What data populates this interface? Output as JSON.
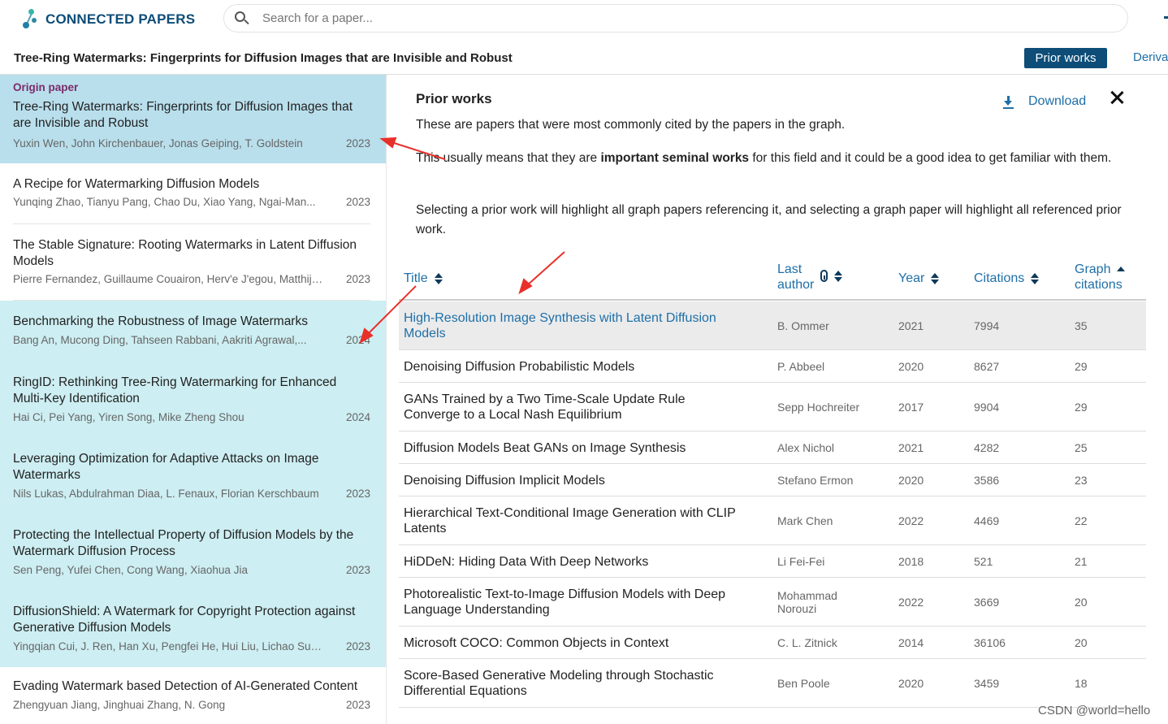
{
  "brand": {
    "name": "CONNECTED PAPERS"
  },
  "search": {
    "placeholder": "Search for a paper..."
  },
  "titlebar": {
    "paper_title": "Tree-Ring Watermarks: Fingerprints for Diffusion Images that are Invisible and Robust",
    "prior_works_label": "Prior works",
    "derivative_label": "Deriva"
  },
  "origin": {
    "label": "Origin paper",
    "title": "Tree-Ring Watermarks: Fingerprints for Diffusion Images that are Invisible and Robust",
    "authors": "Yuxin Wen, John Kirchenbauer, Jonas Geiping, T. Goldstein",
    "year": "2023"
  },
  "list": [
    {
      "title": "A Recipe for Watermarking Diffusion Models",
      "authors": "Yunqing Zhao, Tianyu Pang, Chao Du, Xiao Yang, Ngai-Man...",
      "year": "2023"
    },
    {
      "title": "The Stable Signature: Rooting Watermarks in Latent Diffusion Models",
      "authors": "Pierre Fernandez, Guillaume Couairon, Herv'e J'egou, Matthijs...",
      "year": "2023"
    },
    {
      "title": "Benchmarking the Robustness of Image Watermarks",
      "authors": "Bang An, Mucong Ding, Tahseen Rabbani, Aakriti Agrawal,...",
      "year": "2024"
    },
    {
      "title": "RingID: Rethinking Tree-Ring Watermarking for Enhanced Multi-Key Identification",
      "authors": "Hai Ci, Pei Yang, Yiren Song, Mike Zheng Shou",
      "year": "2024"
    },
    {
      "title": "Leveraging Optimization for Adaptive Attacks on Image Watermarks",
      "authors": "Nils Lukas, Abdulrahman Diaa, L. Fenaux, Florian Kerschbaum",
      "year": "2023"
    },
    {
      "title": "Protecting the Intellectual Property of Diffusion Models by the Watermark Diffusion Process",
      "authors": "Sen Peng, Yufei Chen, Cong Wang, Xiaohua Jia",
      "year": "2023"
    },
    {
      "title": "DiffusionShield: A Watermark for Copyright Protection against Generative Diffusion Models",
      "authors": "Yingqian Cui, J. Ren, Han Xu, Pengfei He, Hui Liu, Lichao Sun,...",
      "year": "2023"
    },
    {
      "title": "Evading Watermark based Detection of AI-Generated Content",
      "authors": "Zhengyuan Jiang, Jinghuai Zhang, N. Gong",
      "year": "2023"
    }
  ],
  "panel": {
    "title": "Prior works",
    "download_label": "Download",
    "desc1": "These are papers that were most commonly cited by the papers in the graph.",
    "desc2_pre": "This usually means that they are ",
    "desc2_bold": "important seminal works",
    "desc2_post": " for this field and it could be a good idea to get familiar with them.",
    "desc3": "Selecting a prior work will highlight all graph papers referencing it, and selecting a graph paper will highlight all referenced prior work."
  },
  "table": {
    "headers": {
      "title": "Title",
      "last_author_1": "Last",
      "last_author_2": "author",
      "year": "Year",
      "citations": "Citations",
      "graph_1": "Graph",
      "graph_2": "citations"
    },
    "rows": [
      {
        "title": "High-Resolution Image Synthesis with Latent Diffusion Models",
        "author": "B. Ommer",
        "year": "2021",
        "citations": "7994",
        "graph": "35"
      },
      {
        "title": "Denoising Diffusion Probabilistic Models",
        "author": "P. Abbeel",
        "year": "2020",
        "citations": "8627",
        "graph": "29"
      },
      {
        "title": "GANs Trained by a Two Time-Scale Update Rule Converge to a Local Nash Equilibrium",
        "author": "Sepp Hochreiter",
        "year": "2017",
        "citations": "9904",
        "graph": "29"
      },
      {
        "title": "Diffusion Models Beat GANs on Image Synthesis",
        "author": "Alex Nichol",
        "year": "2021",
        "citations": "4282",
        "graph": "25"
      },
      {
        "title": "Denoising Diffusion Implicit Models",
        "author": "Stefano Ermon",
        "year": "2020",
        "citations": "3586",
        "graph": "23"
      },
      {
        "title": "Hierarchical Text-Conditional Image Generation with CLIP Latents",
        "author": "Mark Chen",
        "year": "2022",
        "citations": "4469",
        "graph": "22"
      },
      {
        "title": "HiDDeN: Hiding Data With Deep Networks",
        "author": "Li Fei-Fei",
        "year": "2018",
        "citations": "521",
        "graph": "21"
      },
      {
        "title": "Photorealistic Text-to-Image Diffusion Models with Deep Language Understanding",
        "author": "Mohammad Norouzi",
        "year": "2022",
        "citations": "3669",
        "graph": "20"
      },
      {
        "title": "Microsoft COCO: Common Objects in Context",
        "author": "C. L. Zitnick",
        "year": "2014",
        "citations": "36106",
        "graph": "20"
      },
      {
        "title": "Score-Based Generative Modeling through Stochastic Differential Equations",
        "author": "Ben Poole",
        "year": "2020",
        "citations": "3459",
        "graph": "18"
      }
    ]
  },
  "watermark": "CSDN @world=hello",
  "colors": {
    "brand": "#0d4d78",
    "link": "#1e6fa8",
    "origin_bg": "#b9dfec",
    "highlight_bg": "#cdeef2",
    "origin_label": "#7c2b6a",
    "annotation": "#e8302a"
  }
}
